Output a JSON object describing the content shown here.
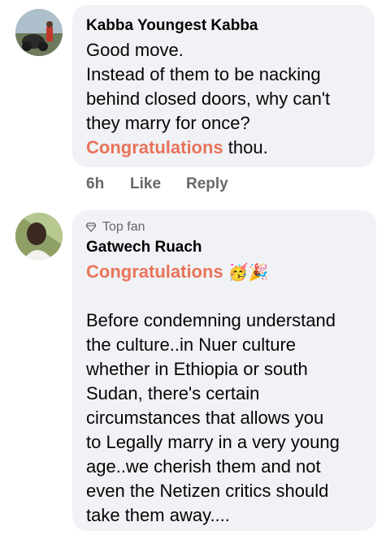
{
  "comments": [
    {
      "author": "Kabba Youngest Kabba",
      "lines": [
        "Good move.",
        "Instead of them to be nacking",
        "behind closed doors, why can't",
        "they marry for once?"
      ],
      "congrats_word": "Congratulations",
      "congrats_suffix": " thou.",
      "time": "6h",
      "like_label": "Like",
      "reply_label": "Reply"
    },
    {
      "badge": "Top fan",
      "author": "Gatwech Ruach",
      "congrats_word": "Congratulations",
      "emojis": "🥳🎉",
      "body_lines": [
        "Before condemning understand",
        "the culture..in Nuer culture",
        "whether in Ethiopia or south",
        "Sudan, there's certain",
        "circumstances that allows you",
        "to Legally marry in a very young",
        "age..we cherish them and not",
        "even the Netizen critics should",
        "take them away...."
      ]
    }
  ],
  "colors": {
    "bubble": "#f0f2f5",
    "link": "#e9735a",
    "meta": "#65676b"
  }
}
